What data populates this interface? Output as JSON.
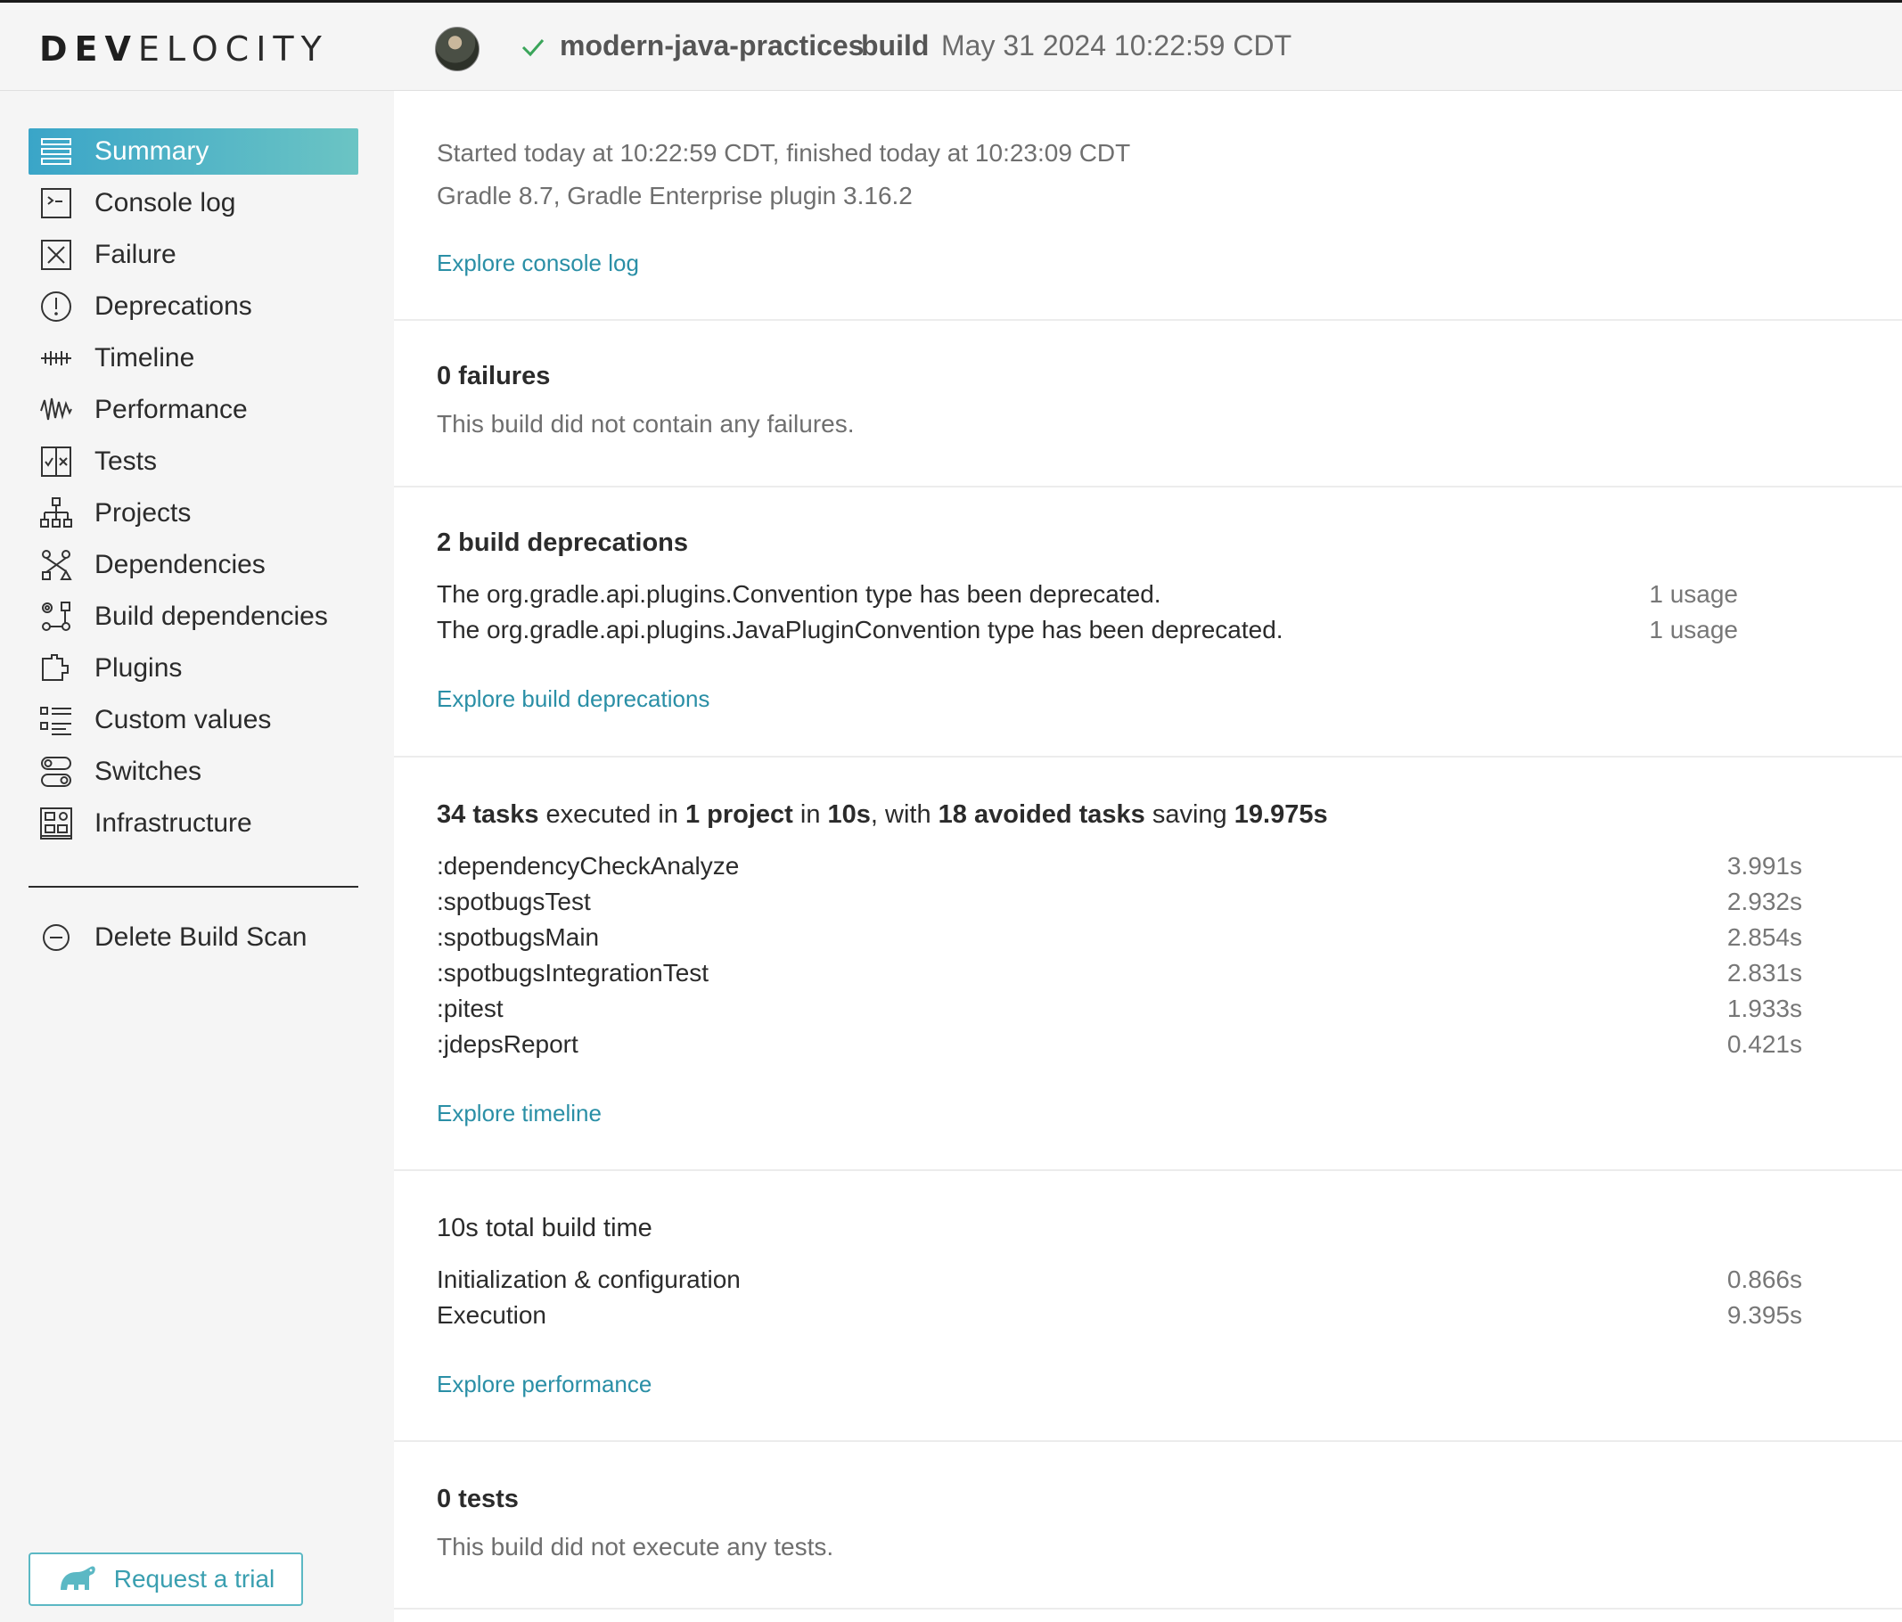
{
  "header": {
    "logo_bold": "DEV",
    "logo_light": "ELOCITY",
    "project": "modern-java-practices",
    "action": "build",
    "date": "May 31 2024 10:22:59 CDT"
  },
  "sidebar": {
    "items": [
      {
        "label": "Summary",
        "icon": "summary-icon",
        "active": true
      },
      {
        "label": "Console log",
        "icon": "console-icon"
      },
      {
        "label": "Failure",
        "icon": "failure-icon"
      },
      {
        "label": "Deprecations",
        "icon": "deprecations-icon"
      },
      {
        "label": "Timeline",
        "icon": "timeline-icon"
      },
      {
        "label": "Performance",
        "icon": "performance-icon"
      },
      {
        "label": "Tests",
        "icon": "tests-icon"
      },
      {
        "label": "Projects",
        "icon": "projects-icon"
      },
      {
        "label": "Dependencies",
        "icon": "dependencies-icon"
      },
      {
        "label": "Build dependencies",
        "icon": "build-dependencies-icon"
      },
      {
        "label": "Plugins",
        "icon": "plugins-icon"
      },
      {
        "label": "Custom values",
        "icon": "custom-values-icon"
      },
      {
        "label": "Switches",
        "icon": "switches-icon"
      },
      {
        "label": "Infrastructure",
        "icon": "infrastructure-icon"
      }
    ],
    "delete_label": "Delete Build Scan",
    "trial_label": "Request a trial"
  },
  "summary": {
    "started": "Started today at 10:22:59 CDT, finished today at 10:23:09 CDT",
    "versions": "Gradle 8.7,  Gradle Enterprise plugin 3.16.2",
    "link": "Explore console log"
  },
  "failures": {
    "title": "0 failures",
    "text": "This build did not contain any failures."
  },
  "deprecations": {
    "title": "2 build deprecations",
    "rows": [
      {
        "text": "The org.gradle.api.plugins.Convention type has been deprecated.",
        "usage": "1 usage"
      },
      {
        "text": "The org.gradle.api.plugins.JavaPluginConvention type has been deprecated.",
        "usage": "1 usage"
      }
    ],
    "link": "Explore build deprecations"
  },
  "tasks": {
    "t1": "34 tasks",
    "t2": " executed in ",
    "t3": "1 project",
    "t4": " in ",
    "t5": "10s",
    "t6": ", with ",
    "t7": "18 avoided tasks",
    "t8": " saving ",
    "t9": "19.975s",
    "rows": [
      {
        "name": ":dependencyCheckAnalyze",
        "time": "3.991s"
      },
      {
        "name": ":spotbugsTest",
        "time": "2.932s"
      },
      {
        "name": ":spotbugsMain",
        "time": "2.854s"
      },
      {
        "name": ":spotbugsIntegrationTest",
        "time": "2.831s"
      },
      {
        "name": ":pitest",
        "time": "1.933s"
      },
      {
        "name": ":jdepsReport",
        "time": "0.421s"
      }
    ],
    "link": "Explore timeline"
  },
  "build_time": {
    "title": "10s total build time",
    "rows": [
      {
        "name": "Initialization & configuration",
        "time": "0.866s"
      },
      {
        "name": "Execution",
        "time": "9.395s"
      }
    ],
    "link": "Explore performance"
  },
  "tests": {
    "title": "0 tests",
    "text": "This build did not execute any tests."
  }
}
